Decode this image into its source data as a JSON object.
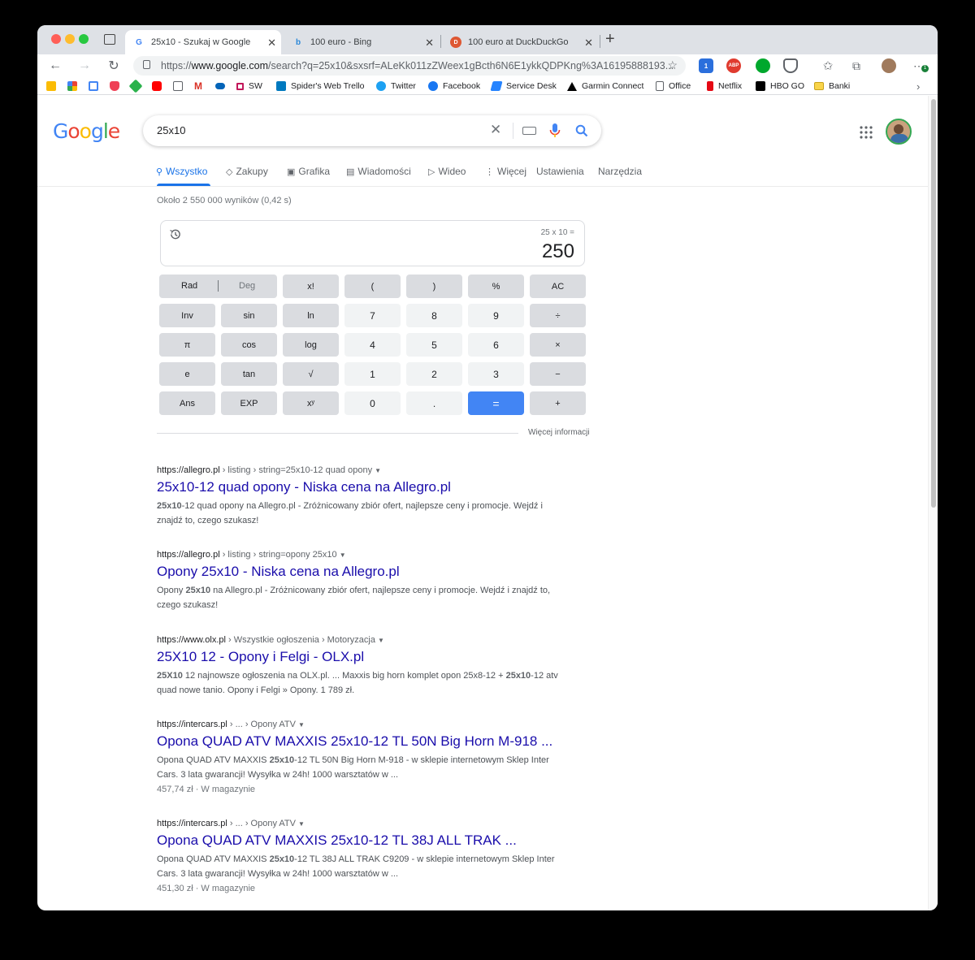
{
  "browser": {
    "tabs": [
      {
        "title": "25x10 - Szukaj w Google"
      },
      {
        "title": "100 euro - Bing"
      },
      {
        "title": "100 euro at DuckDuckGo"
      }
    ],
    "url_prefix": "https://",
    "url_domain": "www.google.com",
    "url_rest": "/search?q=25x10&sxsrf=ALeKk011zZWeex1gBcth6N6E1ykkQDPKng%3A16195888193...",
    "bookmarks": [
      "SW",
      "Spider's Web Trello",
      "Twitter",
      "Facebook",
      "Service Desk",
      "Garmin Connect",
      "Office",
      "Netflix",
      "HBO GO",
      "Banki"
    ],
    "ext_badge_1": "1",
    "ext_badge_2": "1",
    "abp": "ABP"
  },
  "google": {
    "query": "25x10",
    "nav": [
      "Wszystko",
      "Zakupy",
      "Grafika",
      "Wiadomości",
      "Wideo",
      "Więcej",
      "Ustawienia",
      "Narzędzia"
    ],
    "stats": "Około 2 550 000 wyników (0,42 s)"
  },
  "calculator": {
    "expression": "25 x 10 =",
    "result": "250",
    "keys": [
      [
        "Rad",
        "Deg",
        "x!",
        "(",
        ")",
        "%",
        "AC"
      ],
      [
        "Inv",
        "sin",
        "ln",
        "7",
        "8",
        "9",
        "÷"
      ],
      [
        "π",
        "cos",
        "log",
        "4",
        "5",
        "6",
        "×"
      ],
      [
        "e",
        "tan",
        "√",
        "1",
        "2",
        "3",
        "−"
      ],
      [
        "Ans",
        "EXP",
        "xʸ",
        "0",
        ".",
        "=",
        "+"
      ]
    ],
    "more_info": "Więcej informacji"
  },
  "results": [
    {
      "site": "https://allegro.pl",
      "path": " › listing › string=25x10-12 quad opony",
      "title": "25x10-12 quad opony - Niska cena na Allegro.pl",
      "snippet_bold": "25x10",
      "snippet_rest": "-12 quad opony na Allegro.pl - Zróżnicowany zbiór ofert, najlepsze ceny i promocje. Wejdź i znajdź to, czego szukasz!"
    },
    {
      "site": "https://allegro.pl",
      "path": " › listing › string=opony 25x10",
      "title": "Opony 25x10 - Niska cena na Allegro.pl",
      "snippet_pre": "Opony ",
      "snippet_bold": "25x10",
      "snippet_rest": " na Allegro.pl - Zróżnicowany zbiór ofert, najlepsze ceny i promocje. Wejdź i znajdź to, czego szukasz!"
    },
    {
      "site": "https://www.olx.pl",
      "path": " › Wszystkie ogłoszenia › Motoryzacja",
      "title": "25X10 12 - Opony i Felgi - OLX.pl",
      "snippet_bold": "25X10",
      "snippet_mid": " 12 najnowsze ogłoszenia na OLX.pl. ... Maxxis big horn komplet opon 25x8-12 + ",
      "snippet_bold2": "25x10",
      "snippet_rest": "-12 atv quad nowe tanio. Opony i Felgi » Opony. 1 789 zł."
    },
    {
      "site": "https://intercars.pl",
      "path": " › ... › Opony ATV",
      "title": "Opona QUAD ATV MAXXIS 25x10-12 TL 50N Big Horn M-918 ...",
      "snippet_pre": "Opona QUAD ATV MAXXIS ",
      "snippet_bold": "25x10",
      "snippet_rest": "-12 TL 50N Big Horn M-918 - w sklepie internetowym Sklep Inter Cars. 3 lata gwarancji! Wysyłka w 24h! 1000 warsztatów w ...",
      "extra": "457,74 zł · W magazynie"
    },
    {
      "site": "https://intercars.pl",
      "path": " › ... › Opony ATV",
      "title": "Opona QUAD ATV MAXXIS 25x10-12 TL 38J ALL TRAK ...",
      "snippet_pre": "Opona QUAD ATV MAXXIS ",
      "snippet_bold": "25x10",
      "snippet_rest": "-12 TL 38J ALL TRAK C9209 - w sklepie internetowym Sklep Inter Cars. 3 lata gwarancji! Wysyłka w 24h! 1000 warsztatów w ...",
      "extra": "451,30 zł · W magazynie"
    }
  ],
  "colors": {
    "link": "#1a0dab",
    "accent": "#1a73e8",
    "equals": "#4285f4"
  }
}
